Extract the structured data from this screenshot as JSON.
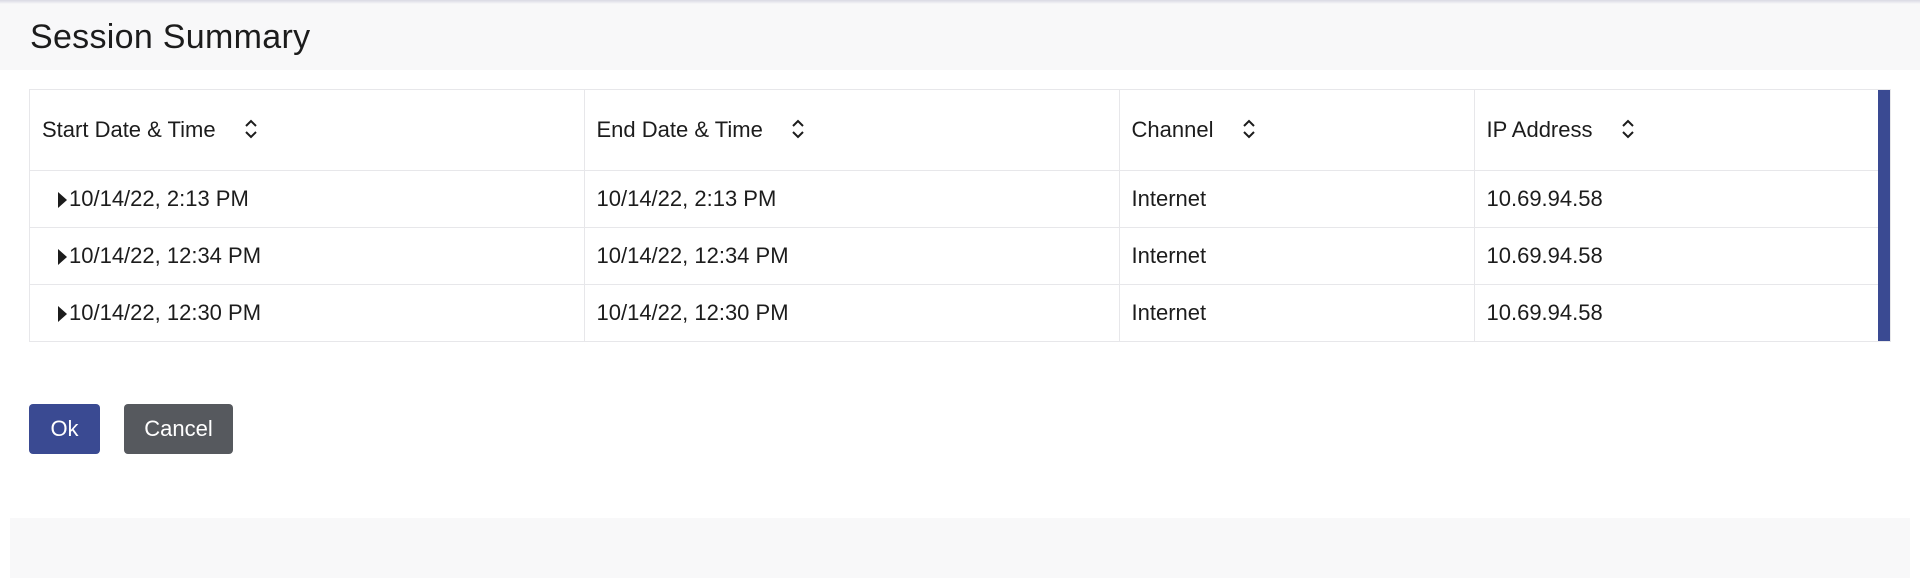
{
  "page": {
    "title": "Session Summary"
  },
  "table": {
    "columns": [
      {
        "label": "Start Date & Time"
      },
      {
        "label": "End Date & Time"
      },
      {
        "label": "Channel"
      },
      {
        "label": "IP Address"
      }
    ],
    "rows": [
      {
        "start": "10/14/22, 2:13 PM",
        "end": "10/14/22, 2:13 PM",
        "channel": "Internet",
        "ip": "10.69.94.58"
      },
      {
        "start": "10/14/22, 12:34 PM",
        "end": "10/14/22, 12:34 PM",
        "channel": "Internet",
        "ip": "10.69.94.58"
      },
      {
        "start": "10/14/22, 12:30 PM",
        "end": "10/14/22, 12:30 PM",
        "channel": "Internet",
        "ip": "10.69.94.58"
      }
    ]
  },
  "actions": {
    "ok_label": "Ok",
    "cancel_label": "Cancel"
  },
  "icons": {
    "sort": "sort-up-down-icon",
    "expand": "caret-right-icon"
  },
  "colors": {
    "primary": "#3a4a92",
    "secondary": "#56595e",
    "band": "#f8f8f9"
  }
}
